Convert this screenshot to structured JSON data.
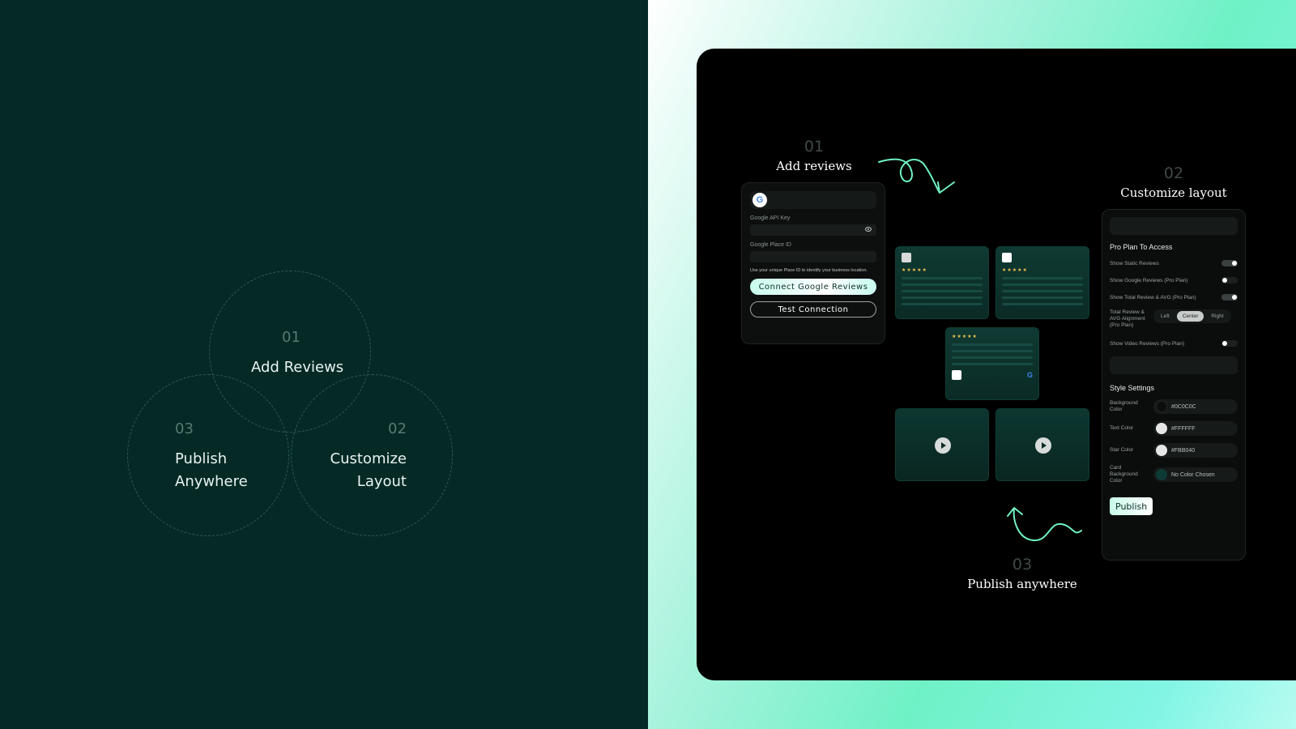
{
  "venn": {
    "top": {
      "num": "01",
      "label": "Add Reviews"
    },
    "left": {
      "num": "03",
      "label_line1": "Publish",
      "label_line2": "Anywhere"
    },
    "right": {
      "num": "02",
      "label_line1": "Customize",
      "label_line2": "Layout"
    }
  },
  "steps": {
    "add": {
      "num": "01",
      "title": "Add reviews"
    },
    "customize": {
      "num": "02",
      "title": "Customize layout"
    },
    "publish": {
      "num": "03",
      "title": "Publish anywhere"
    }
  },
  "connect_card": {
    "google_logo": "G",
    "api_key_label": "Google API Key",
    "place_id_label": "Google Place ID",
    "hint": "Use your unique Place ID to identify your business location.",
    "connect_button": "Connect Google Reviews",
    "test_button": "Test Connection"
  },
  "review_cards": {
    "stars": "★★★★★"
  },
  "layout_panel": {
    "pro_title": "Pro Plan To Access",
    "toggles": [
      {
        "label": "Show Static Reviews",
        "on": true
      },
      {
        "label": "Show Google Reviews (Pro Plan)",
        "on": false
      },
      {
        "label": "Show Total Review & AVG (Pro Plan)",
        "on": true
      }
    ],
    "alignment_label": "Total Review & AVG Alignment (Pro Plan)",
    "alignment_options": [
      "Left",
      "Center",
      "Right"
    ],
    "alignment_selected": "Center",
    "video_toggle": {
      "label": "Show Video Reviews (Pro Plan)",
      "on": false
    },
    "style_title": "Style Settings",
    "colors": [
      {
        "label": "Background Color",
        "value": "#0C0C0C",
        "swatch": "#0c0c0c"
      },
      {
        "label": "Text Color",
        "value": "#FFFFFF",
        "swatch": "#e6e6e6"
      },
      {
        "label": "Star Color",
        "value": "#FBB040",
        "swatch": "#e6e6e6"
      },
      {
        "label": "Card Background Color",
        "value": "No Color Chosen",
        "swatch": "#0d3a34"
      }
    ],
    "publish_button": "Publish"
  },
  "colors": {
    "left_bg": "#052a26",
    "mockup_bg": "#000000",
    "accent": "#6ff1c6"
  }
}
